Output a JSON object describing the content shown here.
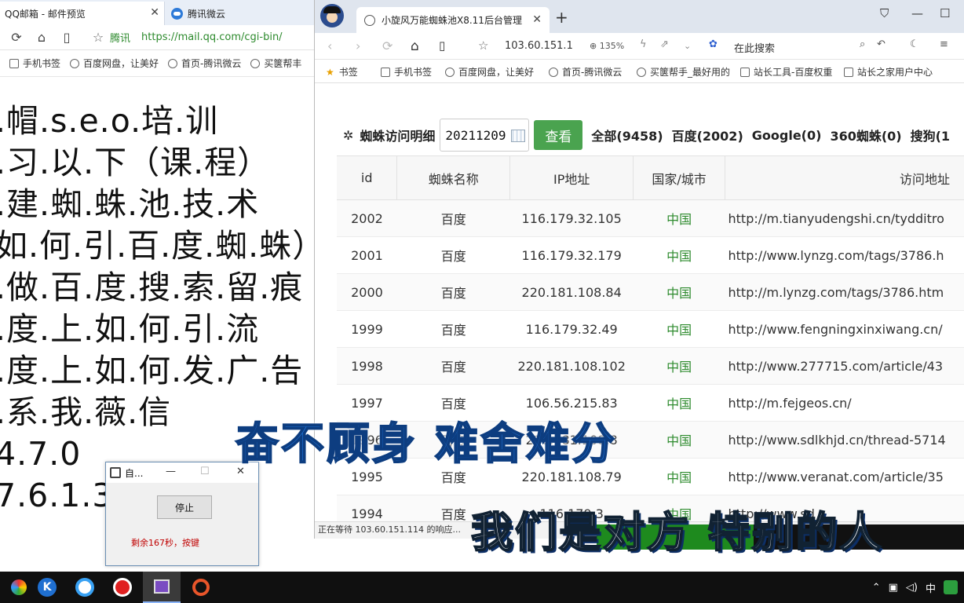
{
  "left_browser": {
    "tabs": [
      {
        "label": "QQ邮箱 - 邮件预览"
      },
      {
        "label": "腾讯微云"
      }
    ],
    "address": {
      "brand": "腾讯",
      "url": "https://mail.qq.com/cgi-bin/"
    },
    "bookmarks": [
      "手机书签",
      "百度网盘，让美好",
      "首页-腾讯微云",
      "买箧帮丰"
    ],
    "content_lines": [
      ".帽.s.e.o.培.训",
      ".习.以.下（课.程）",
      ".建.蜘.蛛.池.技.术",
      "如.何.引.百.度.蜘.蛛）",
      ".做.百.度.搜.索.留.痕",
      ".度.上.如.何.引.流",
      ".度.上.如.何.发.广.告",
      ".系.我.薇.信",
      "4.7.0",
      "7.6.1.3"
    ]
  },
  "timer_dialog": {
    "title": "自...",
    "button": "停止",
    "message": "剩余167秒，按键"
  },
  "right_browser": {
    "tab_title": "小旋风万能蜘蛛池X8.11后台管理",
    "address": "103.60.151.1",
    "zoom": "135%",
    "search_placeholder": "在此搜索",
    "bookmarks": [
      "书签",
      "手机书签",
      "百度网盘，让美好",
      "首页-腾讯微云",
      "买箧帮手_最好用的",
      "站长工具-百度权重",
      "站长之家用户中心"
    ],
    "page": {
      "section_label": "蜘蛛访问明细",
      "date_value": "20211209",
      "view_button": "查看",
      "stats": [
        "全部(9458)",
        "百度(2002)",
        "Google(0)",
        "360蜘蛛(0)",
        "搜狗(1"
      ],
      "table": {
        "headers": [
          "id",
          "蜘蛛名称",
          "IP地址",
          "国家/城市",
          "访问地址"
        ],
        "rows": [
          {
            "id": "2002",
            "name": "百度",
            "ip": "116.179.32.105",
            "country": "中国",
            "url": "http://m.tianyudengshi.cn/tydditro"
          },
          {
            "id": "2001",
            "name": "百度",
            "ip": "116.179.32.179",
            "country": "中国",
            "url": "http://www.lynzg.com/tags/3786.h"
          },
          {
            "id": "2000",
            "name": "百度",
            "ip": "220.181.108.84",
            "country": "中国",
            "url": "http://m.lynzg.com/tags/3786.htm"
          },
          {
            "id": "1999",
            "name": "百度",
            "ip": "116.179.32.49",
            "country": "中国",
            "url": "http://www.fengningxinxiwang.cn/"
          },
          {
            "id": "1998",
            "name": "百度",
            "ip": "220.181.108.102",
            "country": "中国",
            "url": "http://www.277715.com/article/43"
          },
          {
            "id": "1997",
            "name": "百度",
            "ip": "106.56.215.83",
            "country": "中国",
            "url": "http://m.fejgeos.cn/"
          },
          {
            "id": "1996",
            "name": "百度",
            "ip": "220.181.108.8",
            "country": "中国",
            "url": "http://www.sdlkhjd.cn/thread-5714"
          },
          {
            "id": "1995",
            "name": "百度",
            "ip": "220.181.108.79",
            "country": "中国",
            "url": "http://www.veranat.com/article/35"
          },
          {
            "id": "1994",
            "name": "百度",
            "ip": "116.179.3",
            "country": "中国",
            "url": "http://www.sd"
          }
        ]
      }
    },
    "status_text": "正在等待 103.60.151.114 的响应..."
  },
  "subtitles": {
    "line1": "奋不顾身 难舍难分",
    "line2": "我们是对方 特别的人"
  },
  "taskbar": {
    "tray_lang": "中"
  }
}
